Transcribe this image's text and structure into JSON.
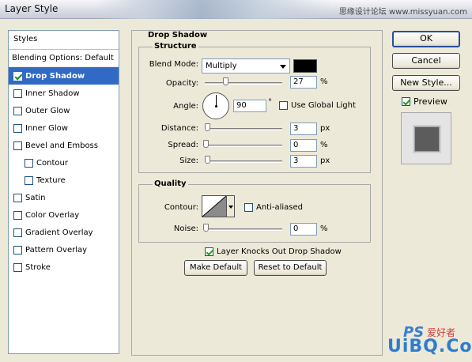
{
  "window": {
    "title": "Layer Style",
    "watermark_top": "思缘设计论坛 www.missyuan.com"
  },
  "sidebar": {
    "header": "Styles",
    "blending": "Blending Options: Default",
    "items": [
      {
        "label": "Drop Shadow",
        "checked": true,
        "selected": true,
        "sub": false
      },
      {
        "label": "Inner Shadow",
        "checked": false,
        "selected": false,
        "sub": false
      },
      {
        "label": "Outer Glow",
        "checked": false,
        "selected": false,
        "sub": false
      },
      {
        "label": "Inner Glow",
        "checked": false,
        "selected": false,
        "sub": false
      },
      {
        "label": "Bevel and Emboss",
        "checked": false,
        "selected": false,
        "sub": false
      },
      {
        "label": "Contour",
        "checked": false,
        "selected": false,
        "sub": true
      },
      {
        "label": "Texture",
        "checked": false,
        "selected": false,
        "sub": true
      },
      {
        "label": "Satin",
        "checked": false,
        "selected": false,
        "sub": false
      },
      {
        "label": "Color Overlay",
        "checked": false,
        "selected": false,
        "sub": false
      },
      {
        "label": "Gradient Overlay",
        "checked": false,
        "selected": false,
        "sub": false
      },
      {
        "label": "Pattern Overlay",
        "checked": false,
        "selected": false,
        "sub": false
      },
      {
        "label": "Stroke",
        "checked": false,
        "selected": false,
        "sub": false
      }
    ]
  },
  "drop_shadow": {
    "title": "Drop Shadow",
    "structure": {
      "title": "Structure",
      "blend_mode_label": "Blend Mode:",
      "blend_mode_value": "Multiply",
      "shadow_color": "#000000",
      "opacity_label": "Opacity:",
      "opacity_value": "27",
      "opacity_unit": "%",
      "opacity_fraction": 0.27,
      "angle_label": "Angle:",
      "angle_value": "90",
      "angle_unit": "°",
      "use_global_light_label": "Use Global Light",
      "use_global_light_checked": false,
      "distance_label": "Distance:",
      "distance_value": "3",
      "distance_unit": "px",
      "spread_label": "Spread:",
      "spread_value": "0",
      "spread_unit": "%",
      "size_label": "Size:",
      "size_value": "3",
      "size_unit": "px"
    },
    "quality": {
      "title": "Quality",
      "contour_label": "Contour:",
      "anti_aliased_label": "Anti-aliased",
      "anti_aliased_checked": false,
      "noise_label": "Noise:",
      "noise_value": "0",
      "noise_unit": "%"
    },
    "knockout_label": "Layer Knocks Out Drop Shadow",
    "knockout_checked": true,
    "make_default_label": "Make Default",
    "reset_default_label": "Reset to Default"
  },
  "actions": {
    "ok_label": "OK",
    "cancel_label": "Cancel",
    "new_style_label": "New Style...",
    "preview_label": "Preview",
    "preview_checked": true
  },
  "watermark_bottom": {
    "ps": "PS",
    "cn": "爱好者",
    "url": "UiBQ.CoM"
  },
  "colors": {
    "selection": "#316ac5",
    "dialog_bg": "#ece9d8",
    "check_mark": "#21a121"
  }
}
